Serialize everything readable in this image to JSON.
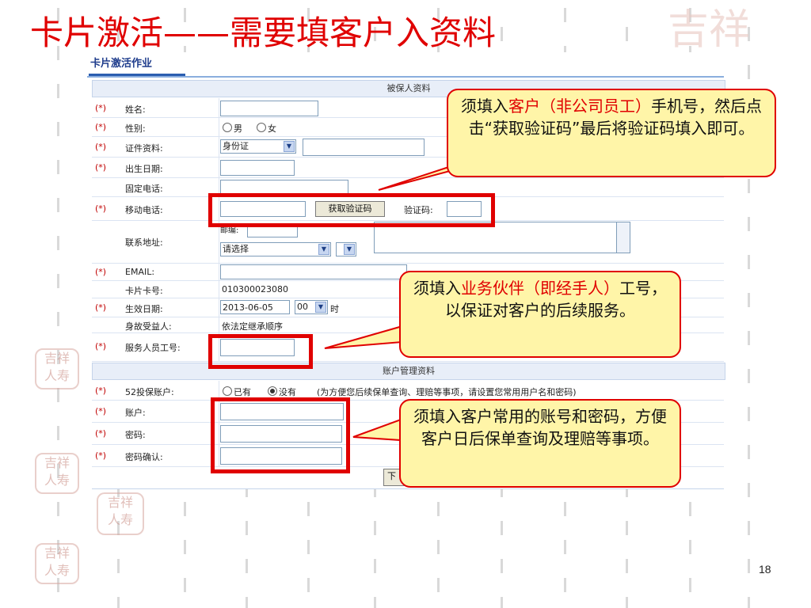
{
  "slide": {
    "title": "卡片激活——需要填客户入资料",
    "page_number": "18"
  },
  "form": {
    "tab_label": "卡片激活作业",
    "section_insured": "被保人资料",
    "section_account": "账户管理资料",
    "required_mark": "(*)",
    "fields": {
      "name_label": "姓名:",
      "gender_label": "性别:",
      "gender_male": "男",
      "gender_female": "女",
      "id_label": "证件资料:",
      "id_type_value": "身份证",
      "birth_label": "出生日期:",
      "phone_label": "固定电话:",
      "mobile_label": "移动电话:",
      "get_code_button": "获取验证码",
      "code_label": "验证码:",
      "address_label": "联系地址:",
      "postcode_label": "邮编:",
      "province_value": "请选择",
      "email_label": "EMAIL:",
      "card_no_label": "卡片卡号:",
      "card_no_value": "010300023080",
      "effective_label": "生效日期:",
      "effective_date_value": "2013-06-05",
      "effective_hour_value": "00",
      "hour_unit": "时",
      "beneficiary_label": "身故受益人:",
      "beneficiary_value": "依法定继承顺序",
      "staff_label": "服务人员工号:",
      "account52_label": "52投保账户:",
      "account_existing": "已有",
      "account_none": "没有",
      "account_hint": "(为方便您后续保单查询、理赔等事项，请设置您常用用户名和密码)",
      "account_label": "账户:",
      "password_label": "密码:",
      "password_confirm_label": "密码确认:",
      "next_button_partial": "下"
    }
  },
  "callouts": {
    "phone": {
      "prefix": "须填入",
      "highlight": "客户（非公司员工）",
      "suffix": "手机号，然后点击“获取验证码”最后将验证码填入即可。"
    },
    "staff": {
      "prefix": "须填入",
      "highlight": "业务伙伴（即经手人）",
      "suffix": "工号，以保证对客户的后续服务。"
    },
    "account": {
      "text": "须填入客户常用的账号和密码，方便客户日后保单查询及理赔等事项。"
    }
  },
  "deco_logo_text": "吉祥人寿",
  "colors": {
    "title_red": "#e00000",
    "callout_fill": "#fff5a8",
    "highlight_box": "#e00000"
  }
}
